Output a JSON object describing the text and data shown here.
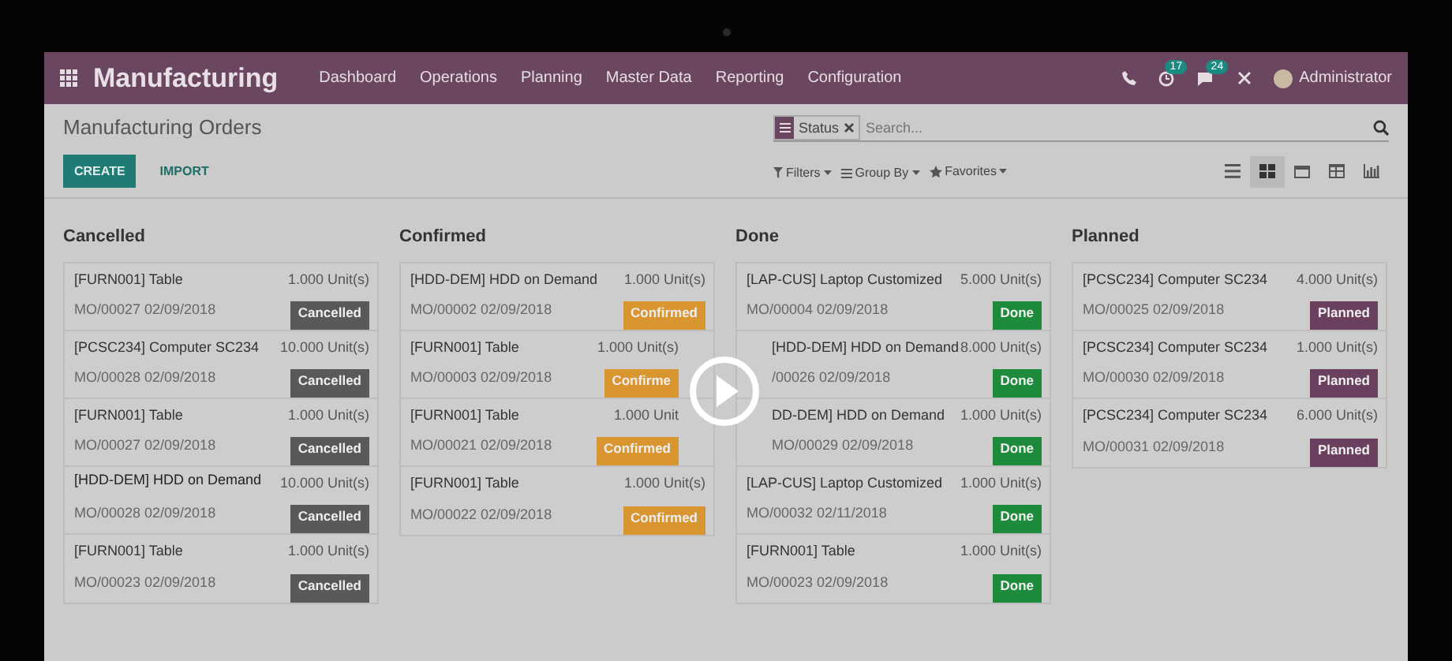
{
  "navbar": {
    "app": "Manufacturing",
    "menu": [
      "Dashboard",
      "Operations",
      "Planning",
      "Master Data",
      "Reporting",
      "Configuration"
    ],
    "activity_count": "17",
    "message_count": "24",
    "user": "Administrator"
  },
  "control_panel": {
    "title": "Manufacturing Orders",
    "buttons": [
      "CREATE",
      "IMPORT"
    ],
    "facet": "Status",
    "search_placeholder": "Search...",
    "filters": [
      "Filters",
      "Group By",
      "Favorites"
    ],
    "views": [
      {
        "kind": "list",
        "selected": false
      },
      {
        "kind": "kanban",
        "selected": true
      },
      {
        "kind": "calendar",
        "selected": false
      },
      {
        "kind": "pivot",
        "selected": false
      },
      {
        "kind": "graph",
        "selected": false
      }
    ]
  },
  "columns": [
    {
      "title": "Cancelled",
      "kind": "cancelled",
      "cards": [
        {
          "kind": "plain",
          "title": "[FURN001] Table",
          "qty": "1.000 Unit(s)",
          "ref": "MO/00027 02/09/2018",
          "status": "Cancelled"
        },
        {
          "kind": "plain",
          "title": "[PCSC234] Computer SC234",
          "qty": "10.000 Unit(s)",
          "ref": "MO/00028 02/09/2018",
          "status": "Cancelled"
        },
        {
          "kind": "plain",
          "title": "[FURN001] Table",
          "qty": "1.000 Unit(s)",
          "ref": "MO/00027 02/09/2018",
          "status": "Cancelled"
        },
        {
          "kind": "dragover",
          "dragged_title": "[HDD-DEM] HDD on Demand",
          "qty": "10.000 Unit(s)",
          "ref": "MO/00028 02/09/2018",
          "status": "Cancelled"
        },
        {
          "kind": "plain",
          "title": "[FURN001] Table",
          "qty": "1.000 Unit(s)",
          "ref": "MO/00023 02/09/2018",
          "status": "Cancelled"
        }
      ]
    },
    {
      "title": "Confirmed",
      "kind": "confirmed",
      "cards": [
        {
          "kind": "plain",
          "title": "[HDD-DEM] HDD on Demand",
          "qty": "1.000 Unit(s)",
          "ref": "MO/00002 02/09/2018",
          "status": "Confirmed"
        },
        {
          "kind": "rightcovered",
          "title": "[FURN001] Table",
          "qty": "1.000 Unit(s)",
          "ref": "MO/00003 02/09/2018",
          "status": "Confirme"
        },
        {
          "kind": "rightcovered",
          "title": "[FURN001] Table",
          "qty": "1.000 Unit",
          "ref": "MO/00021 02/09/2018",
          "status": "Confirmed"
        },
        {
          "kind": "plain",
          "title": "[FURN001] Table",
          "qty": "1.000 Unit(s)",
          "ref": "MO/00022 02/09/2018",
          "status": "Confirmed"
        }
      ]
    },
    {
      "title": "Done",
      "kind": "done",
      "cards": [
        {
          "kind": "plain",
          "title": "[LAP-CUS] Laptop Customized",
          "qty": "5.000 Unit(s)",
          "ref": "MO/00004 02/09/2018",
          "status": "Done"
        },
        {
          "kind": "leftcovered",
          "title": "[HDD-DEM] HDD on Demand",
          "qty": "8.000 Unit(s)",
          "ref": "/00026 02/09/2018",
          "status": "Done"
        },
        {
          "kind": "leftcovered",
          "title": "DD-DEM] HDD on Demand",
          "qty": "1.000 Unit(s)",
          "ref": "MO/00029 02/09/2018",
          "status": "Done"
        },
        {
          "kind": "plain",
          "title": "[LAP-CUS] Laptop Customized",
          "qty": "1.000 Unit(s)",
          "ref": "MO/00032 02/11/2018",
          "status": "Done"
        },
        {
          "kind": "plain",
          "title": "[FURN001] Table",
          "qty": "1.000 Unit(s)",
          "ref": "MO/00023 02/09/2018",
          "status": "Done"
        }
      ]
    },
    {
      "title": "Planned",
      "kind": "planned",
      "cards": [
        {
          "kind": "plain",
          "title": "[PCSC234] Computer SC234",
          "qty": "4.000 Unit(s)",
          "ref": "MO/00025 02/09/2018",
          "status": "Planned"
        },
        {
          "kind": "plain",
          "title": "[PCSC234] Computer SC234",
          "qty": "1.000 Unit(s)",
          "ref": "MO/00030 02/09/2018",
          "status": "Planned"
        },
        {
          "kind": "plain",
          "title": "[PCSC234] Computer SC234",
          "qty": "6.000 Unit(s)",
          "ref": "MO/00031 02/09/2018",
          "status": "Planned"
        }
      ]
    }
  ]
}
